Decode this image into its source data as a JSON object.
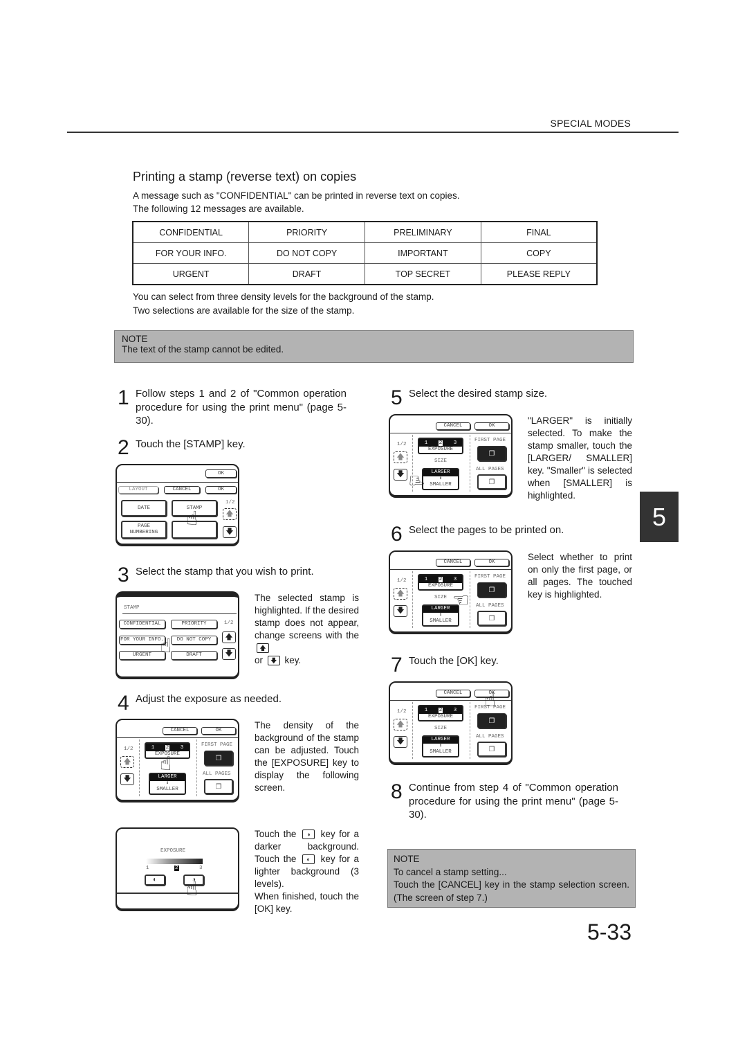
{
  "header": {
    "section": "SPECIAL MODES"
  },
  "title": "Printing a stamp (reverse text) on copies",
  "intro": [
    "A message such as \"CONFIDENTIAL\" can be printed in reverse text on copies.",
    "The following 12 messages are available."
  ],
  "messages_table": [
    [
      "CONFIDENTIAL",
      "PRIORITY",
      "PRELIMINARY",
      "FINAL"
    ],
    [
      "FOR YOUR INFO.",
      "DO NOT COPY",
      "IMPORTANT",
      "COPY"
    ],
    [
      "URGENT",
      "DRAFT",
      "TOP SECRET",
      "PLEASE REPLY"
    ]
  ],
  "info": [
    "You can select from three density levels for the background of the stamp.",
    "Two selections are available for the size of the stamp."
  ],
  "note1": {
    "heading": "NOTE",
    "text": "The text of the stamp cannot be edited."
  },
  "steps": [
    {
      "num": "1",
      "text": "Follow steps 1 and 2 of \"Common operation procedure for using the print menu\" (page 5-30)."
    },
    {
      "num": "2",
      "text": "Touch the [STAMP] key."
    },
    {
      "num": "3",
      "text": "Select the stamp that you wish to print.",
      "desc_parts": [
        "The selected stamp is highlighted. If the desired stamp does not appear, change screens with the",
        "or",
        "key."
      ]
    },
    {
      "num": "4",
      "text": "Adjust the exposure as needed.",
      "desc": "The density of the background of the stamp can be adjusted. Touch the [EXPOSURE] key to display the following screen.",
      "desc2_parts": [
        "Touch the",
        "key for a darker background. Touch the",
        "key for a lighter background (3 levels).",
        "When finished, touch the [OK] key."
      ]
    },
    {
      "num": "5",
      "text": "Select the desired stamp size.",
      "desc": "\"LARGER\" is initially selected. To make the stamp smaller, touch the [LARGER/ SMALLER] key. \"Smaller\" is selected when [SMALLER] is highlighted."
    },
    {
      "num": "6",
      "text": "Select the pages to be printed on.",
      "desc": "Select whether to print on only the first page, or all pages. The touched key is highlighted."
    },
    {
      "num": "7",
      "text": "Touch the [OK] key."
    },
    {
      "num": "8",
      "text": "Continue from step 4 of \"Common operation procedure for using the print menu\" (page 5-30)."
    }
  ],
  "screens": {
    "print_menu": {
      "ok_top": "OK",
      "tabs": [
        "LAYOUT",
        "CANCEL",
        "OK"
      ],
      "keys": [
        "DATE",
        "STAMP",
        "PAGE\nNUMBERING",
        ""
      ],
      "page": "1/2"
    },
    "stamp_select": {
      "heading": "STAMP",
      "keys": [
        "CONFIDENTIAL",
        "PRIORITY",
        "FOR YOUR INFO.",
        "DO NOT COPY",
        "URGENT",
        "DRAFT"
      ],
      "page": "1/2"
    },
    "stamp_settings": {
      "cancel": "CANCEL",
      "ok": "OK",
      "page": "1/2",
      "exposure_levels": [
        "1",
        "2",
        "3"
      ],
      "exposure_selected": 2,
      "exposure_label": "EXPOSURE",
      "size_label": "SIZE",
      "larger": "LARGER",
      "smaller": "SMALLER",
      "first_page": "FIRST PAGE",
      "all_pages": "ALL PAGES"
    },
    "exposure_screen": {
      "heading": "EXPOSURE",
      "levels": [
        "1",
        "2",
        "3"
      ],
      "selected_level": 2
    }
  },
  "note2": {
    "heading": "NOTE",
    "lines": [
      "To cancel a stamp setting...",
      "Touch the [CANCEL] key in the stamp selection screen. (The screen of step 7.)"
    ]
  },
  "chapter_tab": "5",
  "page_number": "5-33"
}
